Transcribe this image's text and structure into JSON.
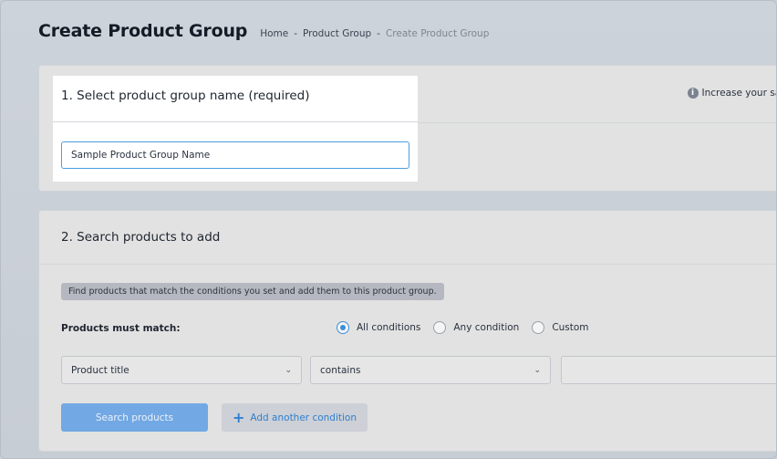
{
  "page": {
    "title": "Create Product Group",
    "breadcrumb": [
      "Home",
      "-",
      "Product Group",
      "-",
      "Create Product Group"
    ]
  },
  "section1": {
    "title": "1. Select product group name (required)",
    "name_value": "Sample Product Group Name",
    "tip": "Increase your sales"
  },
  "section2": {
    "title": "2. Search products to add",
    "hint": "Find products that match the conditions you set and add them to this product group.",
    "match_label": "Products must match:",
    "radio_options": [
      "All conditions",
      "Any condition",
      "Custom"
    ],
    "radio_selected": "All conditions",
    "field_select": "Product title",
    "operator_select": "contains",
    "value_input": "",
    "search_button": "Search products",
    "add_condition_button": "Add another condition"
  },
  "colors": {
    "accent": "#3b8fd9",
    "search_button": "#72a8e3"
  }
}
